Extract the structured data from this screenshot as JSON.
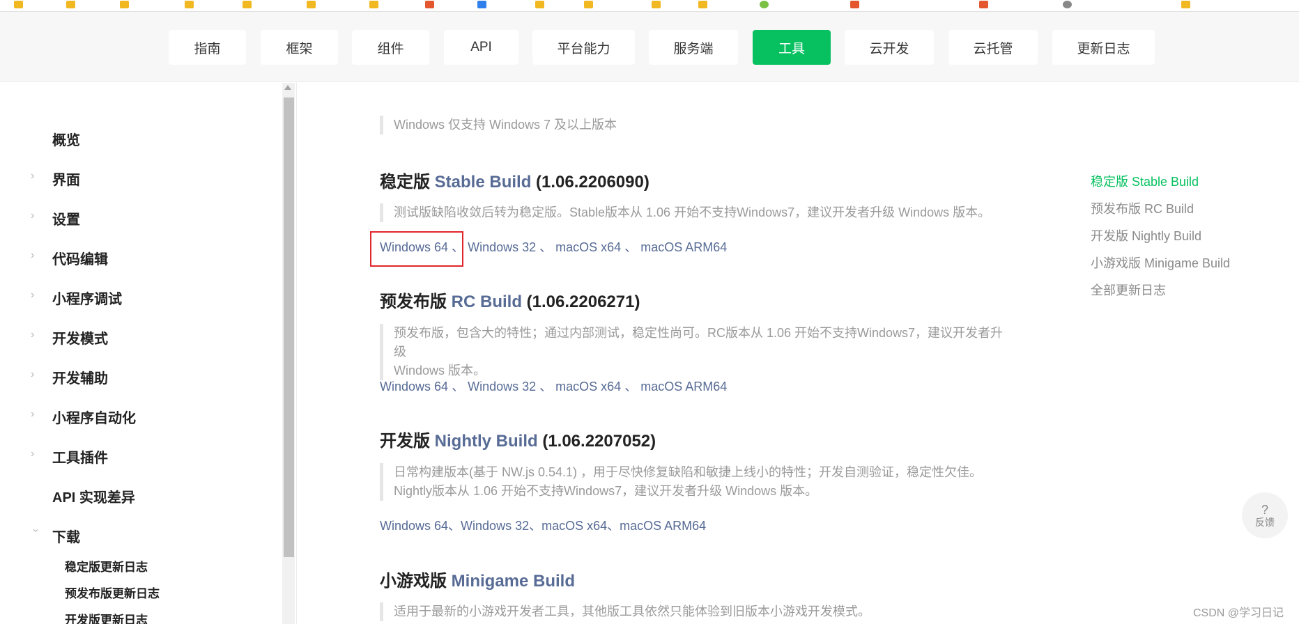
{
  "topnav": {
    "items": [
      {
        "label": "指南"
      },
      {
        "label": "框架"
      },
      {
        "label": "组件"
      },
      {
        "label": "API"
      },
      {
        "label": "平台能力"
      },
      {
        "label": "服务端"
      },
      {
        "label": "工具"
      },
      {
        "label": "云开发"
      },
      {
        "label": "云托管"
      },
      {
        "label": "更新日志"
      }
    ],
    "active": "工具"
  },
  "sidebar": {
    "items": [
      {
        "label": "概览"
      },
      {
        "label": "界面"
      },
      {
        "label": "设置"
      },
      {
        "label": "代码编辑"
      },
      {
        "label": "小程序调试"
      },
      {
        "label": "开发模式"
      },
      {
        "label": "开发辅助"
      },
      {
        "label": "小程序自动化"
      },
      {
        "label": "工具插件"
      },
      {
        "label": "API 实现差异"
      },
      {
        "label": "下载"
      }
    ],
    "subitems": [
      {
        "label": "稳定版更新日志"
      },
      {
        "label": "预发布版更新日志"
      },
      {
        "label": "开发版更新日志"
      }
    ]
  },
  "content": {
    "top_note": "Windows 仅支持 Windows 7 及以上版本",
    "stable": {
      "title_cn": "稳定版",
      "title_en": "Stable Build",
      "version": "(1.06.2206090)",
      "note": "测试版缺陷收敛后转为稳定版。Stable版本从 1.06 开始不支持Windows7，建议开发者升级 Windows 版本。",
      "links": [
        "Windows 64",
        "Windows 32",
        "macOS x64",
        "macOS ARM64"
      ]
    },
    "rc": {
      "title_cn": "预发布版",
      "title_en": "RC Build",
      "version": "(1.06.2206271)",
      "note_line1": "预发布版，包含大的特性；通过内部测试，稳定性尚可。RC版本从 1.06 开始不支持Windows7，建议开发者升级",
      "note_line2": "Windows 版本。",
      "links": [
        "Windows 64",
        "Windows 32",
        "macOS x64",
        "macOS ARM64"
      ]
    },
    "nightly": {
      "title_cn": "开发版",
      "title_en": "Nightly Build",
      "version": "(1.06.2207052)",
      "note_line1": "日常构建版本(基于 NW.js 0.54.1) ，用于尽快修复缺陷和敏捷上线小的特性；开发自测验证，稳定性欠佳。",
      "note_line2": "Nightly版本从 1.06 开始不支持Windows7，建议开发者升级 Windows 版本。",
      "links": [
        "Windows 64",
        "Windows 32",
        "macOS x64",
        "macOS ARM64"
      ]
    },
    "minigame": {
      "title_cn": "小游戏版",
      "title_en": "Minigame Build",
      "note": "适用于最新的小游戏开发者工具，其他版工具依然只能体验到旧版本小游戏开发模式。"
    },
    "sep": "、"
  },
  "toc": {
    "items": [
      {
        "label": "稳定版 Stable Build"
      },
      {
        "label": "预发布版 RC Build"
      },
      {
        "label": "开发版 Nightly Build"
      },
      {
        "label": "小游戏版 Minigame Build"
      },
      {
        "label": "全部更新日志"
      }
    ]
  },
  "feedback": {
    "icon_text": "?",
    "label": "反馈"
  },
  "watermark": "CSDN @学习日记",
  "colors": {
    "accent": "#07c160",
    "link": "#576b95",
    "highlight_box": "#e0262b"
  }
}
